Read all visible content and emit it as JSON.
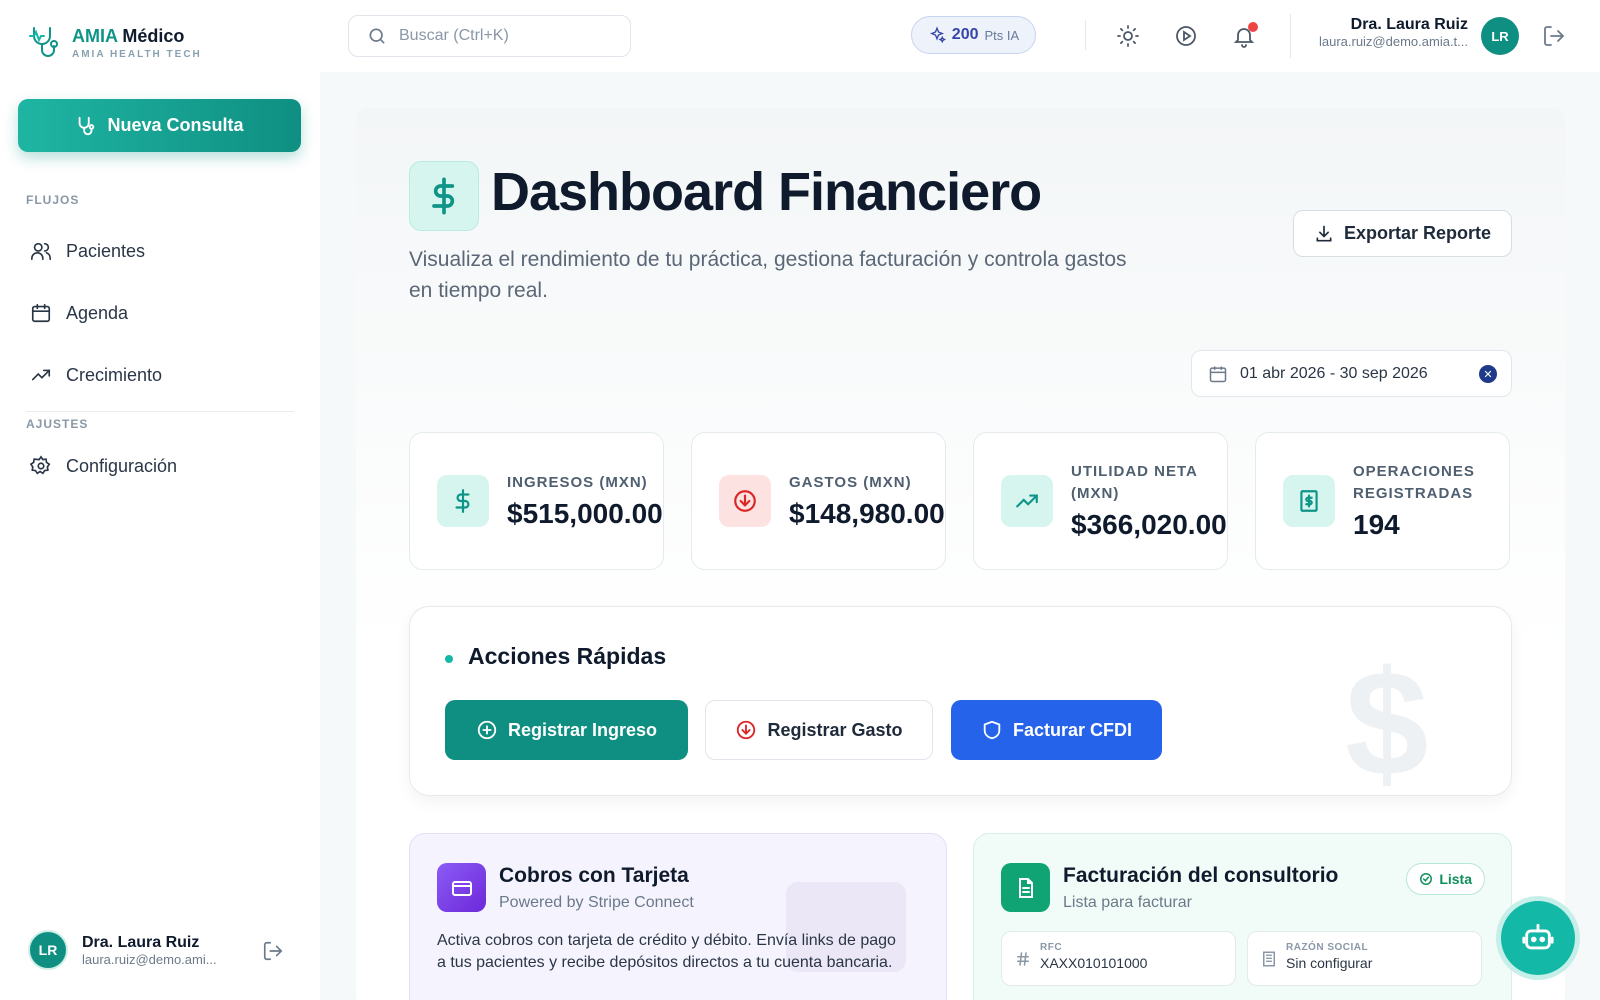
{
  "brand": {
    "name_accent": "AMIA",
    "name_rest": "Médico",
    "tagline": "AMIA HEALTH TECH"
  },
  "sidebar": {
    "new_button": "Nueva Consulta",
    "section_flows": "FLUJOS",
    "section_settings": "AJUSTES",
    "items": [
      {
        "label": "Pacientes",
        "icon": "users-icon"
      },
      {
        "label": "Agenda",
        "icon": "calendar-icon"
      },
      {
        "label": "Crecimiento",
        "icon": "trending-up-icon"
      },
      {
        "label": "Configuración",
        "icon": "gear-icon"
      }
    ],
    "user": {
      "initials": "LR",
      "name": "Dra. Laura Ruiz",
      "email": "laura.ruiz@demo.ami..."
    }
  },
  "topbar": {
    "search_placeholder": "Buscar (Ctrl+K)",
    "points_value": "200",
    "points_label": "Pts IA",
    "user": {
      "initials": "LR",
      "name": "Dra. Laura Ruiz",
      "email": "laura.ruiz@demo.amia.t..."
    }
  },
  "page": {
    "title": "Dashboard Financiero",
    "subtitle": "Visualiza el rendimiento de tu práctica, gestiona facturación y controla gastos en tiempo real.",
    "export_label": "Exportar Reporte",
    "date_range": "01 abr 2026 - 30 sep 2026"
  },
  "kpis": [
    {
      "label": "INGRESOS (MXN)",
      "value": "$515,000.00",
      "icon": "dollar-icon",
      "color": "#0f9488",
      "bg": "#d6f5ee"
    },
    {
      "label": "GASTOS (MXN)",
      "value": "$148,980.00",
      "icon": "arrow-down-circle-icon",
      "color": "#dc2626",
      "bg": "#fde2e2"
    },
    {
      "label": "UTILIDAD NETA (MXN)",
      "value": "$366,020.00",
      "icon": "trending-up-icon",
      "color": "#0f9488",
      "bg": "#d6f5ee"
    },
    {
      "label": "OPERACIONES REGISTRADAS",
      "value": "194",
      "icon": "receipt-icon",
      "color": "#0f9488",
      "bg": "#d6f5ee"
    }
  ],
  "quick_actions": {
    "title": "Acciones Rápidas",
    "buttons": [
      {
        "label": "Registrar Ingreso",
        "icon": "plus-circle-icon"
      },
      {
        "label": "Registrar Gasto",
        "icon": "arrow-down-circle-icon"
      },
      {
        "label": "Facturar CFDI",
        "icon": "shield-icon"
      }
    ]
  },
  "stripe_card": {
    "title": "Cobros con Tarjeta",
    "subtitle": "Powered by Stripe Connect",
    "body": "Activa cobros con tarjeta de crédito y débito. Envía links de pago a tus pacientes y recibe depósitos directos a tu cuenta bancaria."
  },
  "billing_card": {
    "title": "Facturación del consultorio",
    "subtitle": "Lista para facturar",
    "badge": "Lista",
    "fields": [
      {
        "label": "RFC",
        "value": "XAXX010101000",
        "icon": "hash-icon"
      },
      {
        "label": "RAZÓN SOCIAL",
        "value": "Sin configurar",
        "icon": "building-icon"
      }
    ]
  },
  "colors": {
    "primary": "#0f9488",
    "blue": "#2563eb",
    "danger": "#dc2626"
  }
}
